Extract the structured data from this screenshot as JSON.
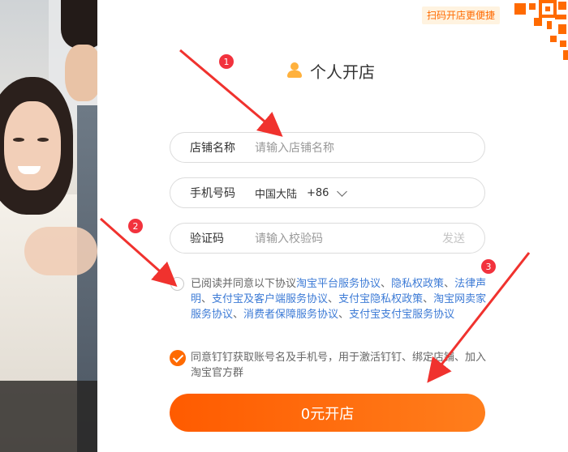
{
  "qr_tip": "扫码开店更便捷",
  "title": {
    "text": "个人开店",
    "icon": "person-icon"
  },
  "fields": {
    "shop_name": {
      "label": "店铺名称",
      "placeholder": "请输入店铺名称"
    },
    "phone": {
      "label": "手机号码",
      "region": "中国大陆",
      "code": "+86"
    },
    "verify": {
      "label": "验证码",
      "placeholder": "请输入校验码",
      "send": "发送"
    }
  },
  "agreement": {
    "prefix": "已阅读并同意以下协议",
    "links": [
      "淘宝平台服务协议",
      "隐私权政策",
      "法律声明",
      "支付宝及客户端服务协议",
      "支付宝隐私权政策",
      "淘宝网卖家服务协议",
      "消费者保障服务协议",
      "支付宝支付宝服务协议"
    ],
    "separator": "、"
  },
  "dingtalk_consent": "同意钉钉获取账号名及手机号，用于激活钉钉、绑定店铺、加入淘宝官方群",
  "submit": "0元开店",
  "badges": [
    "1",
    "2",
    "3"
  ],
  "colors": {
    "accent": "#ff6a00",
    "link": "#3d7bd6",
    "badge": "#f2323d",
    "icon": "#ffb13d"
  }
}
